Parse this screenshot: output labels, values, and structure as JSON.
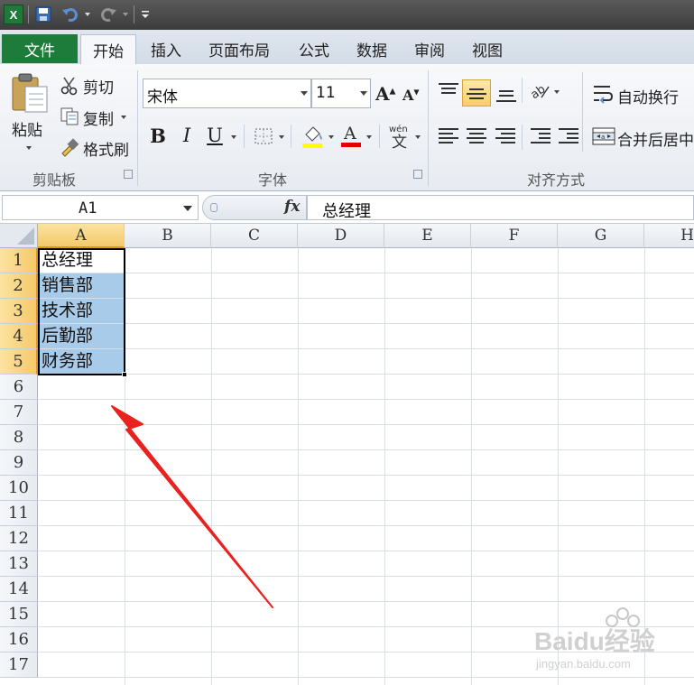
{
  "quick_access": {
    "app_icon": "excel-icon",
    "save_icon": "save-icon",
    "undo_icon": "undo-icon",
    "redo_icon": "redo-icon",
    "customize_icon": "customize-icon"
  },
  "tabs": {
    "file": "文件",
    "items": [
      "开始",
      "插入",
      "页面布局",
      "公式",
      "数据",
      "审阅",
      "视图"
    ],
    "active": "开始"
  },
  "ribbon": {
    "clipboard": {
      "paste": "粘贴",
      "cut": "剪切",
      "copy": "复制",
      "format_painter": "格式刷",
      "label": "剪贴板"
    },
    "font": {
      "font_name": "宋体",
      "font_size": "11",
      "bold": "B",
      "italic": "I",
      "underline": "U",
      "label": "字体",
      "fill_color": "#ffff00",
      "font_color": "#e00000"
    },
    "alignment": {
      "wrap_text": "自动换行",
      "merge_center": "合并后居中",
      "label": "对齐方式"
    }
  },
  "formula_bar": {
    "name_box": "A1",
    "fx": "fx",
    "content": "总经理"
  },
  "grid": {
    "columns": [
      "A",
      "B",
      "C",
      "D",
      "E",
      "F",
      "G",
      "H"
    ],
    "rows": [
      "1",
      "2",
      "3",
      "4",
      "5",
      "6",
      "7",
      "8",
      "9",
      "10",
      "11",
      "12",
      "13",
      "14",
      "15",
      "16",
      "17"
    ],
    "cells_a": [
      "总经理",
      "销售部",
      "技术部",
      "后勤部",
      "财务部"
    ]
  },
  "watermark": {
    "brand": "Baidu经验",
    "url": "jingyan.baidu.com"
  },
  "colors": {
    "accent_green": "#1e7c3b",
    "selection_blue": "#a9cbea",
    "arrow_red": "#e8231f"
  }
}
